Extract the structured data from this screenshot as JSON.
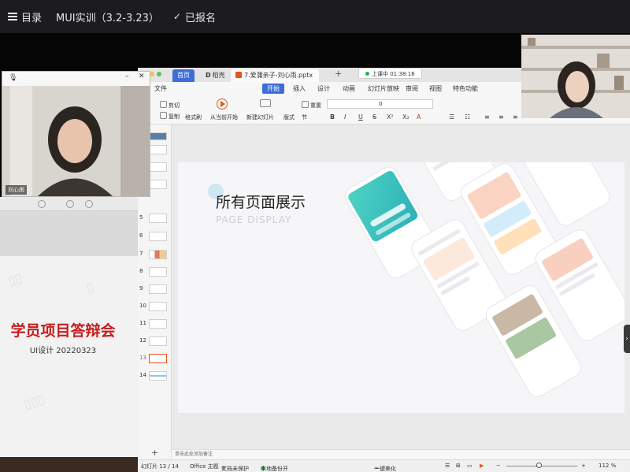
{
  "topbar": {
    "catalog_label": "目录",
    "course_title": "MUI实训（3.2-3.23）",
    "enrolled_label": "已报名"
  },
  "wps": {
    "tabs": {
      "home": "首页",
      "daoke": "稻壳",
      "document": "7.爱蒲亲子-刘心雨.pptx"
    },
    "timer": "上课中 01:38:16",
    "menu": {
      "file": "文件",
      "start": "开始",
      "insert": "插入",
      "design": "设计",
      "animation": "动画",
      "slideshow": "幻灯片放映",
      "review": "审阅",
      "view": "视图",
      "special": "特色功能"
    },
    "toolbar": {
      "cut": "剪切",
      "copy": "复制",
      "format_painter": "格式刷",
      "play_from_start": "从当前开始",
      "new_slide": "新建幻灯片",
      "layout": "版式",
      "section": "节",
      "reset": "重置",
      "font_size": "0"
    },
    "thumbnails": [
      "5",
      "6",
      "7",
      "8",
      "9",
      "10",
      "11",
      "12",
      "13",
      "14"
    ],
    "active_thumbnail": "13",
    "slide": {
      "title": "所有页面展示",
      "subtitle": "PAGE DISPLAY"
    },
    "notes_placeholder": "单击此处添加备注",
    "status": {
      "slide_counter": "幻灯片 13 / 14",
      "theme": "Office 主题",
      "protect": "文档未保护",
      "backup": "本地备份开",
      "beautify": "一键美化",
      "zoom": "112 %"
    }
  },
  "left_panel": {
    "title": "学员项目答辩会",
    "subtitle": "UI设计 20220323"
  },
  "video": {
    "participant_name": "刘心雨"
  }
}
